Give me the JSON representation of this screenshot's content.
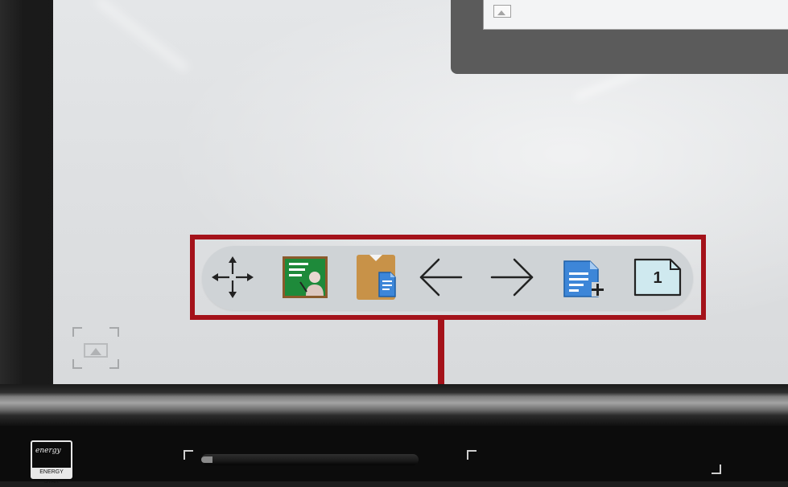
{
  "screen": {
    "background": "#e0e2e4"
  },
  "toolbar": {
    "tools": [
      {
        "name": "move",
        "icon": "move-arrows-icon"
      },
      {
        "name": "teacher-board",
        "icon": "presenter-board-icon"
      },
      {
        "name": "clipboard-document",
        "icon": "clipboard-document-icon"
      },
      {
        "name": "previous-page",
        "icon": "arrow-left-icon"
      },
      {
        "name": "next-page",
        "icon": "arrow-right-icon"
      },
      {
        "name": "add-page",
        "icon": "add-page-icon"
      },
      {
        "name": "page-indicator",
        "icon": "page-number-icon"
      }
    ],
    "page_number": "1"
  },
  "annotation": {
    "color": "#a4121a"
  },
  "badge": {
    "script_text": "energy",
    "label": "ENERGY STAR"
  }
}
